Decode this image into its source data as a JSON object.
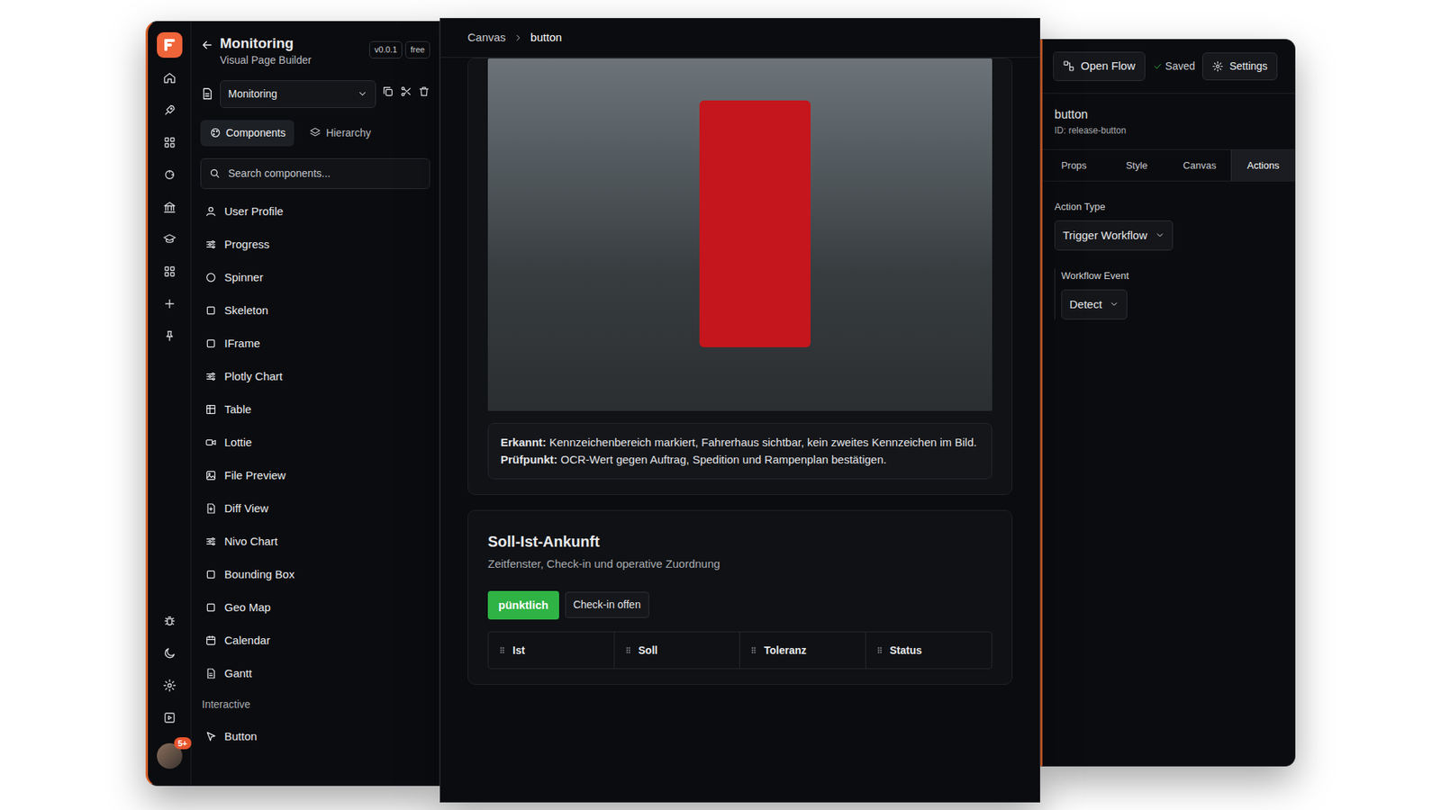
{
  "app": {
    "notification_count": "5+"
  },
  "header": {
    "title": "Monitoring",
    "subtitle": "Visual Page Builder",
    "version": "v0.0.1",
    "plan": "free"
  },
  "page_select": {
    "value": "Monitoring"
  },
  "panel_tabs": [
    {
      "label": "Components",
      "selected": true
    },
    {
      "label": "Hierarchy",
      "selected": false
    }
  ],
  "search": {
    "placeholder": "Search components..."
  },
  "components": [
    "User Profile",
    "Progress",
    "Spinner",
    "Skeleton",
    "IFrame",
    "Plotly Chart",
    "Table",
    "Lottie",
    "File Preview",
    "Diff View",
    "Nivo Chart",
    "Bounding Box",
    "Geo Map",
    "Calendar",
    "Gantt"
  ],
  "interactive": {
    "heading": "Interactive",
    "items": [
      "Button"
    ]
  },
  "breadcrumb": [
    "Canvas",
    "button"
  ],
  "detection": {
    "label1": "Erkannt:",
    "text1": "Kennzeichenbereich markiert, Fahrerhaus sichtbar, kein zweites Kennzeichen im Bild.",
    "label2": "Prüfpunkt:",
    "text2": "OCR-Wert gegen Auftrag, Spedition und Rampenplan bestätigen."
  },
  "arrival": {
    "title": "Soll-Ist-Ankunft",
    "subtitle": "Zeitfenster, Check-in und operative Zuordnung",
    "badges": [
      {
        "label": "pünktlich",
        "color": "#2fb344"
      },
      {
        "label": "Check-in offen",
        "color": "#15171b"
      }
    ],
    "columns": [
      "Ist",
      "Soll",
      "Toleranz",
      "Status"
    ]
  },
  "toolbar": {
    "open_flow": "Open Flow",
    "saved": "Saved",
    "settings": "Settings"
  },
  "element": {
    "name": "button",
    "id": "ID: release-button"
  },
  "prop_tabs": [
    {
      "label": "Props",
      "selected": false
    },
    {
      "label": "Style",
      "selected": false
    },
    {
      "label": "Canvas",
      "selected": false
    },
    {
      "label": "Actions",
      "selected": true
    }
  ],
  "form": [
    {
      "label": "Action Type",
      "value": "Trigger Workflow"
    },
    {
      "label": "Workflow Event",
      "value": "Detect"
    }
  ]
}
